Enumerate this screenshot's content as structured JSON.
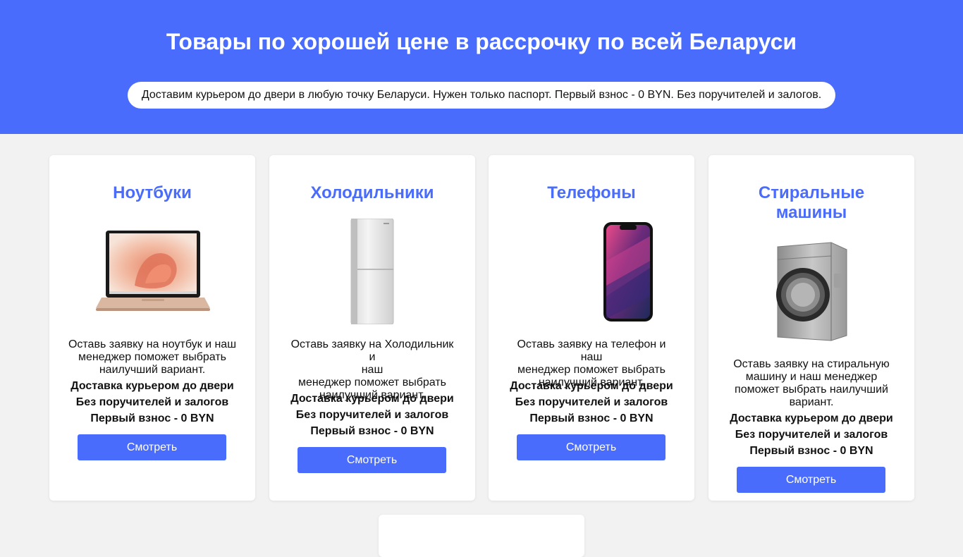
{
  "header": {
    "title": "Товары по хорошей цене в рассрочку по всей Беларуси",
    "subtitle": "Доставим курьером до двери в любую точку Беларуси. Нужен только паспорт. Первый взнос - 0 BYN. Без поручителей и залогов."
  },
  "cards": [
    {
      "title": "Ноутбуки",
      "image": "laptop-image",
      "desc": [
        "Оставь заявку на ноутбук и наш",
        "менеджер поможет выбрать",
        "наилучший вариант."
      ],
      "features": [
        "Доставка курьером до двери",
        "Без поручителей и залогов",
        "Первый взнос - 0 BYN"
      ],
      "button": "Смотреть"
    },
    {
      "title": "Холодильники",
      "image": "refrigerator-image",
      "desc": [
        "Оставь заявку на Холодильник и",
        "наш",
        "менеджер поможет выбрать",
        "наилучший вариант."
      ],
      "features": [
        "Доставка курьером до двери",
        "Без поручителей и залогов",
        "Первый взнос - 0 BYN"
      ],
      "button": "Смотреть"
    },
    {
      "title": "Телефоны",
      "image": "phone-image",
      "desc": [
        "Оставь заявку на телефон и наш",
        "менеджер поможет выбрать",
        "наилучший вариант."
      ],
      "features": [
        "Доставка курьером до двери",
        "Без поручителей и залогов",
        "Первый взнос - 0 BYN"
      ],
      "button": "Смотреть"
    },
    {
      "title_lines": [
        "Стиральные",
        "машины"
      ],
      "image": "washing-machine-image",
      "desc": [
        "Оставь заявку на стиральную",
        "машину и наш менеджер",
        "поможет выбрать наилучший",
        "вариант."
      ],
      "features": [
        "Доставка курьером до двери",
        "Без поручителей и залогов",
        "Первый взнос - 0 BYN"
      ],
      "button": "Смотреть"
    }
  ],
  "colors": {
    "accent": "#4a6cfd",
    "background": "#f2f2f2",
    "card": "#ffffff"
  }
}
